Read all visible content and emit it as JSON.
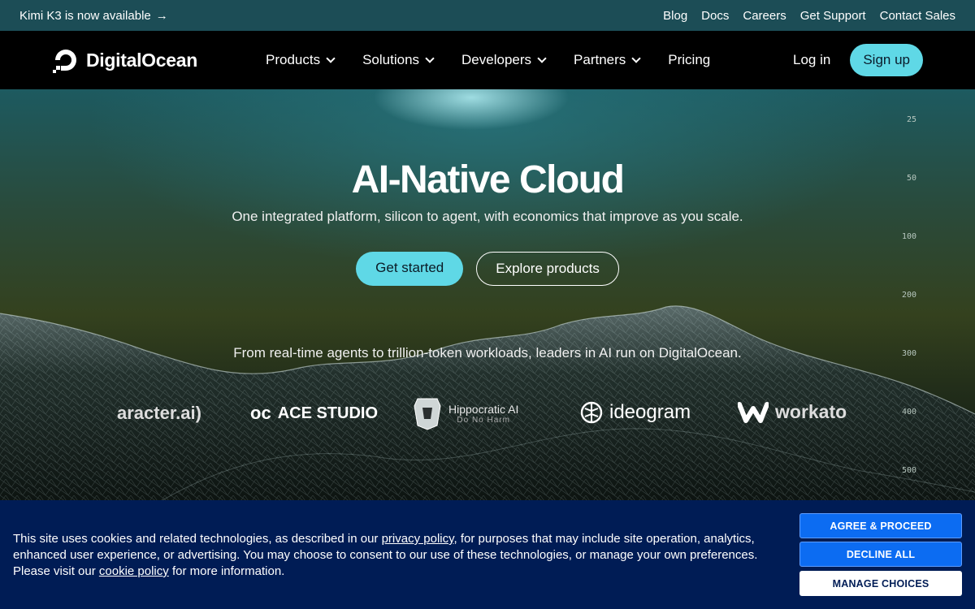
{
  "announcement": {
    "text": "Kimi K3 is now available",
    "arrow": "→",
    "links": [
      "Blog",
      "Docs",
      "Careers",
      "Get Support",
      "Contact Sales"
    ]
  },
  "nav": {
    "logo_text": "DigitalOcean",
    "menu": [
      "Products",
      "Solutions",
      "Developers",
      "Partners",
      "Pricing"
    ],
    "login": "Log in",
    "signup": "Sign up"
  },
  "hero": {
    "title": "AI-Native Cloud",
    "subtitle": "One integrated platform, silicon to agent, with economics that improve as you scale.",
    "primary_cta": "Get started",
    "secondary_cta": "Explore products",
    "leaders_text": "From real-time agents to trillion-token workloads, leaders in AI run on DigitalOcean.",
    "scale": [
      "25",
      "50",
      "100",
      "200",
      "300",
      "400",
      "500"
    ],
    "brands": {
      "character": "aracter.ai)",
      "ace": "ACE STUDIO",
      "ace_mark": "oc",
      "hippocratic": "Hippocratic AI",
      "hippocratic_tag": "Do No Harm",
      "ideogram": "ideogram",
      "workato": "workato"
    }
  },
  "cookie": {
    "text_1": "This site uses cookies and related technologies, as described in our ",
    "privacy_link": "privacy policy",
    "text_2": ", for purposes that may include site operation, analytics, enhanced user experience, or advertising. You may choose to consent to our use of these technologies, or manage your own preferences. Please visit our ",
    "cookie_link": "cookie policy",
    "text_3": " for more information.",
    "agree": "AGREE & PROCEED",
    "decline": "DECLINE ALL",
    "manage": "MANAGE CHOICES"
  },
  "colors": {
    "accent": "#5fd8e6",
    "announcement_bg": "#1c4d56",
    "cookie_bg": "#001c55",
    "cookie_button_blue": "#0c6cf2"
  }
}
